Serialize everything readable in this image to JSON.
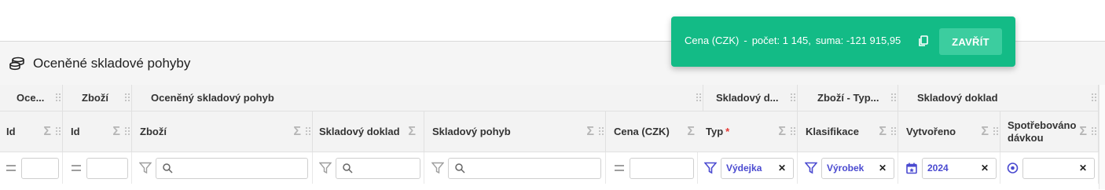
{
  "page": {
    "title": "Oceněné skladové pohyby",
    "title_icon": "coins-stack-icon"
  },
  "groups": [
    {
      "label": "Oce..."
    },
    {
      "label": "Zboží"
    },
    {
      "label": "Oceněný skladový pohyb"
    },
    {
      "label": "Skladový d..."
    },
    {
      "label": "Zboží - Typ..."
    },
    {
      "label": "Skladový doklad"
    }
  ],
  "columns": [
    {
      "label": "Id"
    },
    {
      "label": "Id"
    },
    {
      "label": "Zboží"
    },
    {
      "label": "Skladový doklad"
    },
    {
      "label": "Skladový pohyb"
    },
    {
      "label": "Cena (CZK)"
    },
    {
      "label": "Typ",
      "required_mark": "*"
    },
    {
      "label": "Klasifikace"
    },
    {
      "label": "Vytvořeno"
    },
    {
      "label": "Spotřebováno dávkou"
    }
  ],
  "filters": {
    "typ": "Výdejka",
    "klasifikace": "Výrobek",
    "vytvoreno": "2024",
    "clear_symbol": "✕"
  },
  "sigma_symbol": "Σ",
  "toast": {
    "field": "Cena (CZK)",
    "sep": "-",
    "count_label": "počet: 1 145,",
    "sum_label": "suma: -121 915,95",
    "close_label": "ZAVŘÍT",
    "copy_icon": "copy-icon"
  },
  "colors": {
    "toast_bg": "#13bb86",
    "accent_blue": "#4a4ad0",
    "required": "#e53935"
  }
}
